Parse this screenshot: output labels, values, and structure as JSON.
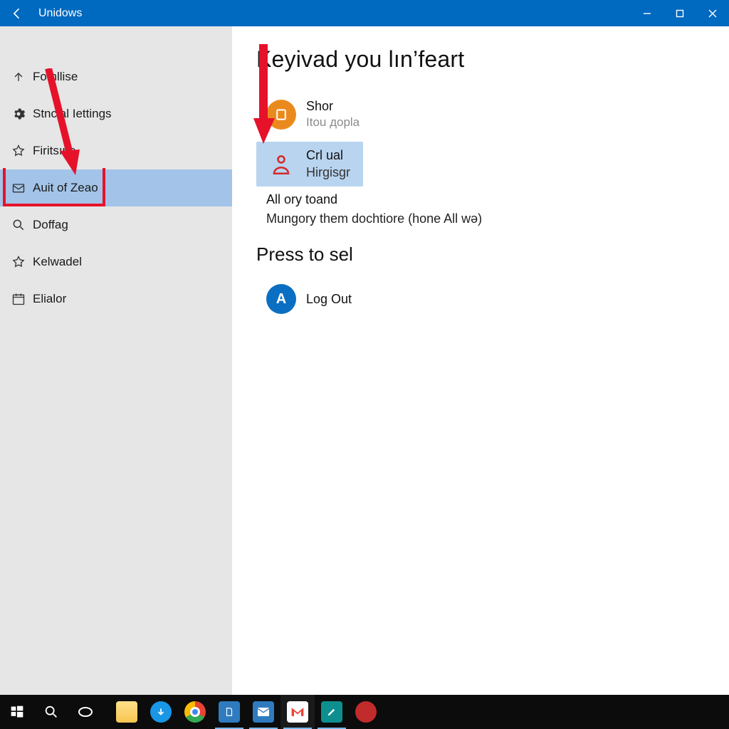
{
  "titlebar": {
    "title": "Unidows"
  },
  "sidebar": {
    "items": [
      {
        "label": "Fomllise"
      },
      {
        "label": "Stncial Iettings"
      },
      {
        "label": "Firitsıne"
      },
      {
        "label": "Auit of Zeao"
      },
      {
        "label": "Doffag"
      },
      {
        "label": "Kelwadel"
      },
      {
        "label": "Elialor"
      }
    ]
  },
  "main": {
    "heading1": "Keyivad you lın’feart",
    "card1": {
      "title": "Shor",
      "subtitle": "Itou дopla"
    },
    "card2": {
      "title": "Crl ual",
      "subtitle": "Hirgisgr"
    },
    "line1": "All ory toand",
    "line2": "Mungory them dochtiore (hone All wə)",
    "heading2": "Press to sel",
    "card3": {
      "letter": "A",
      "title": "Log Out"
    }
  },
  "taskbar": {
    "items": [
      "start",
      "search",
      "task-view",
      "file-explorer",
      "downloads",
      "chrome",
      "notepad",
      "mail",
      "gmail",
      "pen",
      "red-app"
    ]
  }
}
